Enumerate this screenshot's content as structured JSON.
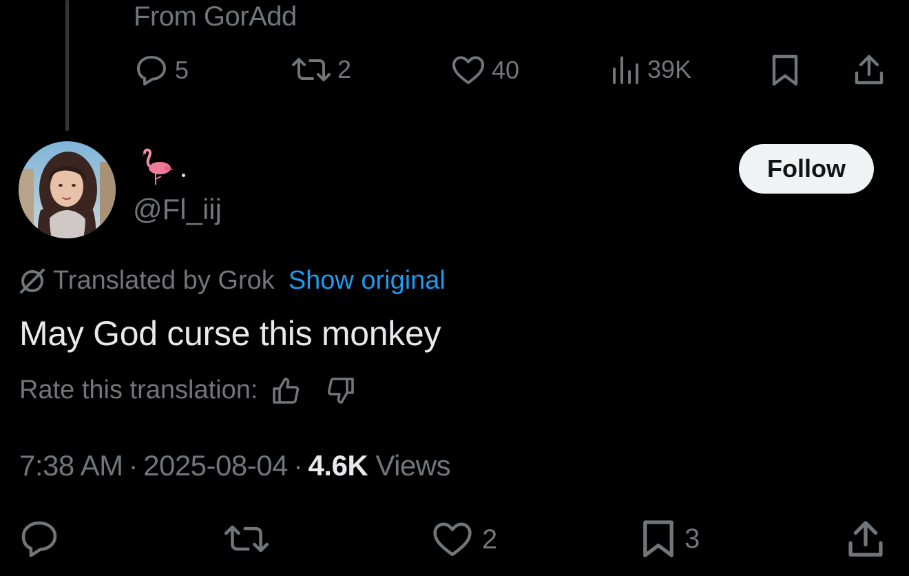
{
  "parent_tweet": {
    "source": "From GorAdd",
    "replies": "5",
    "reposts": "2",
    "likes": "40",
    "views": "39K"
  },
  "reply_tweet": {
    "author_emoji": "flamingo",
    "handle": "@Fl_iij",
    "follow_label": "Follow",
    "translated_by": "Translated by Grok",
    "show_original": "Show original",
    "text": "May God curse this monkey",
    "rate_label": "Rate this translation:",
    "time": "7:38 AM",
    "date": "2025-08-04",
    "views_count": "4.6K",
    "views_label": "Views",
    "likes": "2",
    "bookmarks": "3"
  },
  "colors": {
    "background": "#000000",
    "text_primary": "#e7e9ea",
    "text_secondary": "#71767b",
    "link": "#1d9bf0",
    "follow_bg": "#eff3f4"
  }
}
